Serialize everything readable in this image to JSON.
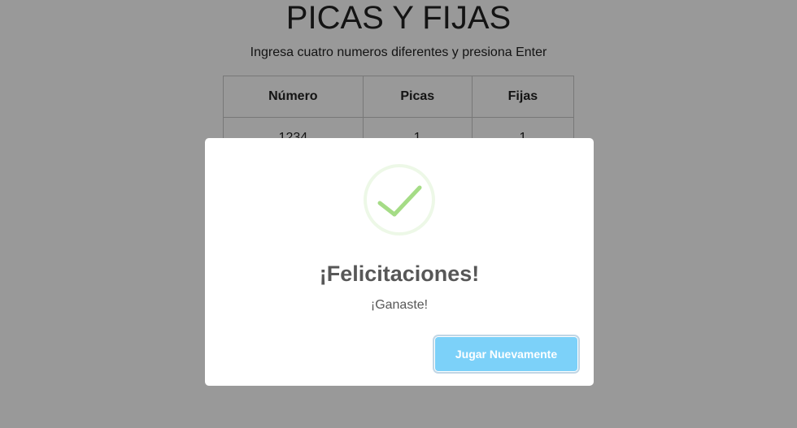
{
  "page": {
    "title": "PICAS Y FIJAS",
    "instructions": "Ingresa cuatro numeros diferentes y presiona Enter"
  },
  "table": {
    "headers": [
      "Número",
      "Picas",
      "Fijas"
    ],
    "rows": [
      {
        "numero": "1234",
        "picas": "1",
        "fijas": "1"
      }
    ]
  },
  "modal": {
    "icon": "success-check-icon",
    "title": "¡Felicitaciones!",
    "text": "¡Ganaste!",
    "button_label": "Jugar Nuevamente",
    "colors": {
      "success": "#a5dc86",
      "button": "#7cd1f9",
      "text": "#575757"
    }
  }
}
